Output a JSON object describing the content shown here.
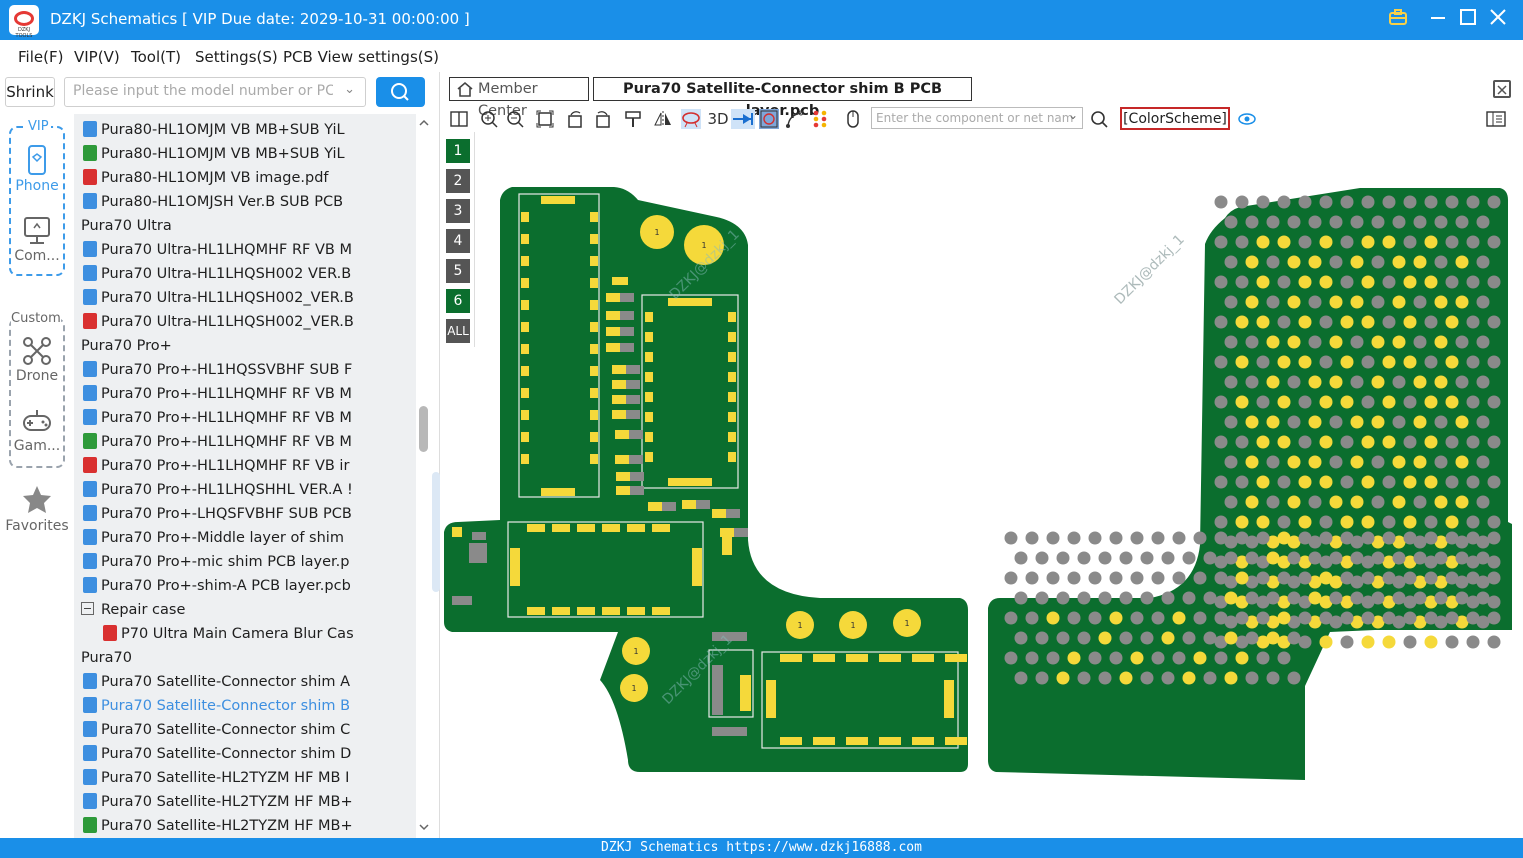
{
  "window": {
    "title": "DZKJ Schematics [ VIP Due date: 2029-10-31 00:00:00 ]",
    "logo_text": "DZKJ TOOLS"
  },
  "menu": [
    "File(F)",
    "VIP(V)",
    "Tool(T)",
    "Settings(S)",
    "PCB View settings(S)"
  ],
  "left": {
    "shrink_label": "Shrink",
    "search_placeholder": "Please input the model number or PCB"
  },
  "categories": {
    "vip_label": "VIP",
    "custom_label": "Custom",
    "phone": "Phone",
    "computer": "Com...",
    "drone": "Drone",
    "games": "Gam...",
    "favorites": "Favorites"
  },
  "tree": [
    {
      "indent": 1,
      "icon": "pcb",
      "label": "Pura80-HL1OMJM VB MB+SUB YiL"
    },
    {
      "indent": 1,
      "icon": "img",
      "label": "Pura80-HL1OMJM VB MB+SUB YiL"
    },
    {
      "indent": 1,
      "icon": "pdf",
      "label": "Pura80-HL1OMJM VB image.pdf"
    },
    {
      "indent": 1,
      "icon": "pcb",
      "label": "Pura80-HL1OMJSH Ver.B SUB PCB"
    },
    {
      "indent": 0,
      "icon": "toggle",
      "label": "Pura70 Ultra"
    },
    {
      "indent": 1,
      "icon": "pcb",
      "label": "Pura70 Ultra-HL1LHQMHF RF VB M"
    },
    {
      "indent": 1,
      "icon": "pcb",
      "label": "Pura70 Ultra-HL1LHQSH002 VER.B"
    },
    {
      "indent": 1,
      "icon": "pcb",
      "label": "Pura70 Ultra-HL1LHQSH002_VER.B"
    },
    {
      "indent": 1,
      "icon": "pdf",
      "label": "Pura70 Ultra-HL1LHQSH002_VER.B"
    },
    {
      "indent": 0,
      "icon": "toggle",
      "label": "Pura70 Pro+"
    },
    {
      "indent": 1,
      "icon": "pcb",
      "label": "Pura70 Pro+-HL1HQSSVBHF SUB F"
    },
    {
      "indent": 1,
      "icon": "pcb",
      "label": "Pura70 Pro+-HL1LHQMHF RF VB M"
    },
    {
      "indent": 1,
      "icon": "pcb",
      "label": "Pura70 Pro+-HL1LHQMHF RF VB M"
    },
    {
      "indent": 1,
      "icon": "img",
      "label": "Pura70 Pro+-HL1LHQMHF RF VB M"
    },
    {
      "indent": 1,
      "icon": "pdf",
      "label": "Pura70 Pro+-HL1LHQMHF RF VB ir"
    },
    {
      "indent": 1,
      "icon": "pcb",
      "label": "Pura70 Pro+-HL1LHQSHHL VER.A !"
    },
    {
      "indent": 1,
      "icon": "pcb",
      "label": "Pura70 Pro+-LHQSFVBHF SUB PCB"
    },
    {
      "indent": 1,
      "icon": "pcb",
      "label": "Pura70 Pro+-Middle layer of shim"
    },
    {
      "indent": 1,
      "icon": "pcb",
      "label": "Pura70 Pro+-mic shim PCB layer.p"
    },
    {
      "indent": 1,
      "icon": "pcb",
      "label": "Pura70 Pro+-shim-A PCB layer.pcb"
    },
    {
      "indent": 1,
      "icon": "toggle",
      "label": "Repair case"
    },
    {
      "indent": 2,
      "icon": "pdf",
      "label": "P70 Ultra Main Camera Blur Cas"
    },
    {
      "indent": 0,
      "icon": "toggle",
      "label": "Pura70"
    },
    {
      "indent": 1,
      "icon": "pcb",
      "label": "Pura70 Satellite-Connector shim A"
    },
    {
      "indent": 1,
      "icon": "pcb",
      "label": "Pura70 Satellite-Connector shim B",
      "selected": true
    },
    {
      "indent": 1,
      "icon": "pcb",
      "label": "Pura70 Satellite-Connector shim C"
    },
    {
      "indent": 1,
      "icon": "pcb",
      "label": "Pura70 Satellite-Connector shim D"
    },
    {
      "indent": 1,
      "icon": "pcb",
      "label": "Pura70 Satellite-HL2TYZM HF MB I"
    },
    {
      "indent": 1,
      "icon": "pcb",
      "label": "Pura70 Satellite-HL2TYZM HF MB+"
    },
    {
      "indent": 1,
      "icon": "img",
      "label": "Pura70 Satellite-HL2TYZM HF MB+"
    }
  ],
  "viewer": {
    "home_tab": "Member Center",
    "active_tab": "Pura70 Satellite-Connector shim B PCB layer.pcb",
    "tool_3d": "3D",
    "component_search_placeholder": "Enter the component or net nam",
    "color_scheme": "[ColorScheme]",
    "layers": [
      "1",
      "2",
      "3",
      "4",
      "5",
      "6",
      "ALL"
    ],
    "watermark": "DZKJ@dzkj_1",
    "pad_label": "1"
  },
  "colors": {
    "accent": "#1a8fe8",
    "board": "#0b6e2e",
    "pad": "#f5d93a",
    "grey_pad": "#8a8a8a"
  },
  "status": "DZKJ Schematics https://www.dzkj16888.com"
}
